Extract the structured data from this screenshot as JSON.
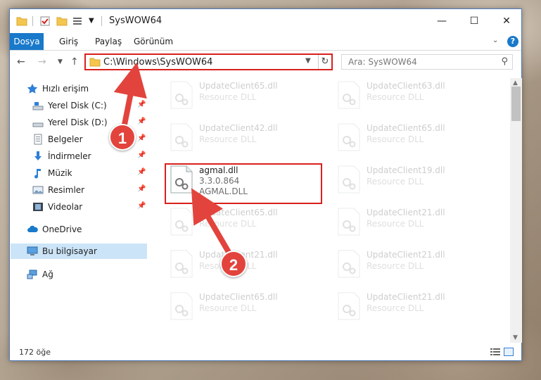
{
  "window": {
    "title": "SysWOW64",
    "controls": {
      "minimize": "—",
      "maximize": "☐",
      "close": "✕"
    }
  },
  "ribbon": {
    "tabs": [
      "Dosya",
      "Giriş",
      "Paylaş",
      "Görünüm"
    ],
    "help_label": "?"
  },
  "navigation": {
    "address": "C:\\Windows\\SysWOW64",
    "search_placeholder": "Ara: SysWOW64"
  },
  "nav_pane": {
    "quick_access": "Hızlı erişim",
    "items": [
      {
        "label": "Yerel Disk (C:)",
        "icon": "drive-icon",
        "pinned": true
      },
      {
        "label": "Yerel Disk (D:)",
        "icon": "drive-icon",
        "pinned": true
      },
      {
        "label": "Belgeler",
        "icon": "documents-icon",
        "pinned": true
      },
      {
        "label": "İndirmeler",
        "icon": "downloads-icon",
        "pinned": true
      },
      {
        "label": "Müzik",
        "icon": "music-icon",
        "pinned": true
      },
      {
        "label": "Resimler",
        "icon": "pictures-icon",
        "pinned": true
      },
      {
        "label": "Videolar",
        "icon": "videos-icon",
        "pinned": true
      }
    ],
    "onedrive": "OneDrive",
    "this_pc": "Bu bilgisayar",
    "network": "Ağ"
  },
  "files": {
    "left_column": [
      {
        "name": "UpdateClient65.dll",
        "desc": "Resource DLL"
      },
      {
        "name": "UpdateClient42.dll",
        "desc": "Resource DLL"
      },
      {
        "name": "agmal.dll",
        "version": "3.3.0.864",
        "desc": "AGMAL.DLL",
        "highlighted": true
      },
      {
        "name": "UpdateClient65.dll",
        "desc": "Resource DLL"
      },
      {
        "name": "UpdateClient21.dll",
        "desc": "Resource DLL"
      },
      {
        "name": "UpdateClient65.dll",
        "desc": "Resource DLL"
      }
    ],
    "right_column": [
      {
        "name": "UpdateClient63.dll",
        "desc": "Resource DLL"
      },
      {
        "name": "UpdateClient65.dll",
        "desc": "Resource DLL"
      },
      {
        "name": "UpdateClient19.dll",
        "desc": "Resource DLL"
      },
      {
        "name": "UpdateClient21.dll",
        "desc": "Resource DLL"
      },
      {
        "name": "UpdateClient21.dll",
        "desc": "Resource DLL"
      },
      {
        "name": "UpdateClient21.dll",
        "desc": "Resource DLL"
      }
    ]
  },
  "status": {
    "item_count": "172 öğe"
  },
  "callouts": [
    "1",
    "2"
  ],
  "colors": {
    "accent": "#1979ca",
    "highlight": "#d9201d",
    "callout": "#e2443d",
    "selected": "#cce4f7"
  }
}
